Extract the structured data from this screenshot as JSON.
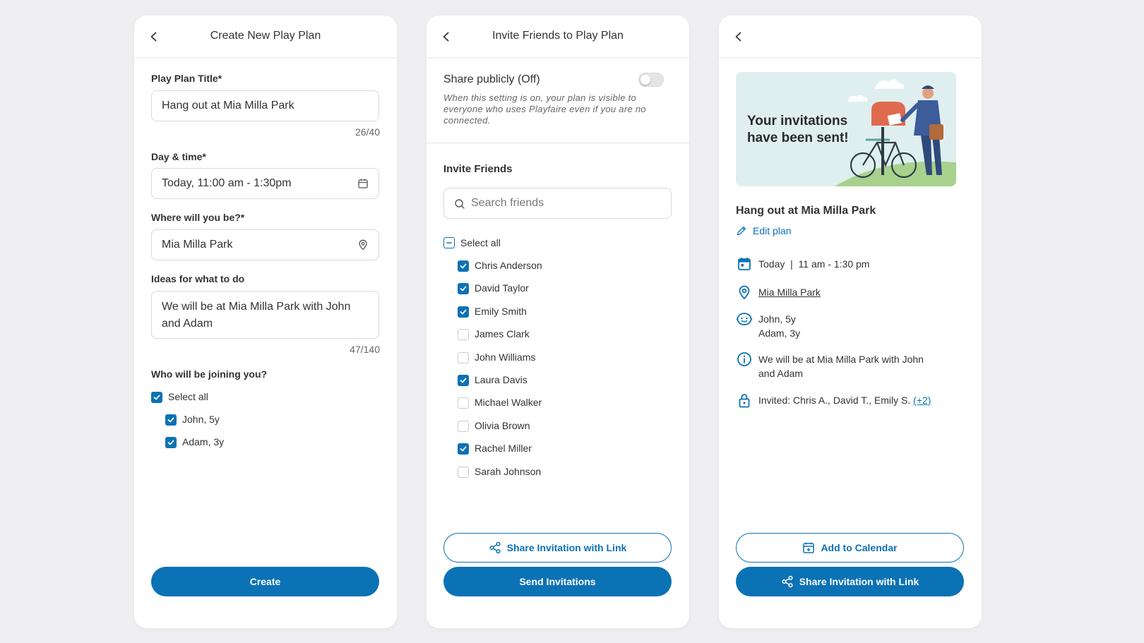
{
  "colors": {
    "primary": "#0b72b5",
    "background": "#efeff1",
    "card": "#ffffff"
  },
  "create_screen": {
    "title": "Create New Play Plan",
    "title_label": "Play Plan Title*",
    "title_value": "Hang out at Mia Milla Park",
    "title_counter": "26/40",
    "datetime_label": "Day & time*",
    "datetime_value": "Today, 11:00 am - 1:30pm",
    "where_label": "Where will you be?*",
    "where_value": "Mia Milla Park",
    "ideas_label": "Ideas for what to do",
    "ideas_value": "We will be at Mia Milla Park with John and Adam",
    "ideas_counter": "47/140",
    "joining_label": "Who will be joining you?",
    "select_all": "Select all",
    "kids": [
      {
        "label": "John, 5y",
        "checked": true
      },
      {
        "label": "Adam, 3y",
        "checked": true
      }
    ],
    "create_button": "Create"
  },
  "invite_screen": {
    "title": "Invite Friends to Play Plan",
    "share_publicly_label": "Share publicly (Off)",
    "share_publicly_on": false,
    "share_note": "When this setting is on, your plan is visible to everyone who uses Playfaire even if you are no connected.",
    "invite_heading": "Invite Friends",
    "search_placeholder": "Search friends",
    "select_all": "Select all",
    "friends": [
      {
        "label": "Chris Anderson",
        "checked": true
      },
      {
        "label": "David Taylor",
        "checked": true
      },
      {
        "label": "Emily Smith",
        "checked": true
      },
      {
        "label": "James Clark",
        "checked": false
      },
      {
        "label": "John Williams",
        "checked": false
      },
      {
        "label": "Laura Davis",
        "checked": true
      },
      {
        "label": "Michael Walker",
        "checked": false
      },
      {
        "label": "Olivia Brown",
        "checked": false
      },
      {
        "label": "Rachel Miller",
        "checked": true
      },
      {
        "label": "Sarah Johnson",
        "checked": false
      }
    ],
    "share_link_button": "Share Invitation with Link",
    "send_button": "Send Invitations"
  },
  "confirm_screen": {
    "banner_line1": "Your invitations",
    "banner_line2": "have been sent!",
    "plan_title": "Hang out at Mia Milla Park",
    "edit_plan": "Edit plan",
    "datetime": "Today  |  11 am - 1:30 pm",
    "location": "Mia Milla Park",
    "kids_line1": "John, 5y",
    "kids_line2": "Adam, 3y",
    "ideas": "We will be at Mia Milla Park with John and Adam",
    "invited_text": "Invited: Chris A., David T., Emily S. ",
    "invited_more": "(+2)",
    "add_calendar_button": "Add to Calendar",
    "share_link_button": "Share Invitation with Link"
  }
}
